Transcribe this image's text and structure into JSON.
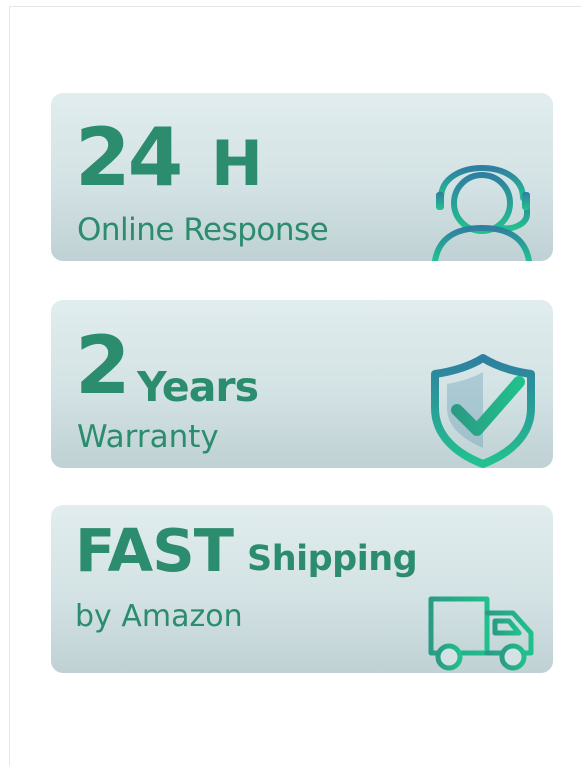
{
  "cards": [
    {
      "big": "24",
      "medium": "H",
      "sub": "Online Response",
      "icon": "headset-agent-icon"
    },
    {
      "big": "2",
      "medium": "Years",
      "sub": "Warranty",
      "icon": "shield-check-icon"
    },
    {
      "big": "FAST",
      "medium": "Shipping",
      "sub": "by Amazon",
      "icon": "delivery-truck-icon"
    }
  ],
  "colors": {
    "text": "#2b8c6e",
    "icon_gradient_start": "#2f7fa0",
    "icon_gradient_end": "#22c28f",
    "card_bg_top": "#e1edee",
    "card_bg_bottom": "#bfd1d4"
  }
}
